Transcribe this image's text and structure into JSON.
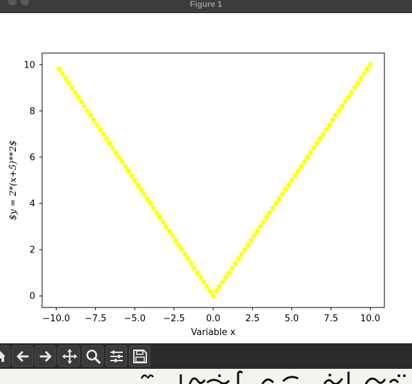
{
  "window": {
    "title": "Figure 1"
  },
  "chart_data": {
    "type": "scatter",
    "marker": "*",
    "color": "#ffff00",
    "title": "",
    "xlabel": "Variable x",
    "ylabel": "$y = 2*(x+5)**2$",
    "xlim": [
      -10.9,
      10.9
    ],
    "ylim": [
      -0.5,
      10.5
    ],
    "xticks": [
      -10.0,
      -7.5,
      -5.0,
      -2.5,
      0.0,
      2.5,
      5.0,
      7.5,
      10.0
    ],
    "xtick_labels": [
      "−10.0",
      "−7.5",
      "−5.0",
      "−2.5",
      "0.0",
      "2.5",
      "5.0",
      "7.5",
      "10.0"
    ],
    "yticks": [
      0,
      2,
      4,
      6,
      8,
      10
    ],
    "ytick_labels": [
      "0",
      "2",
      "4",
      "6",
      "8",
      "10"
    ],
    "grid": false,
    "series": [
      {
        "x_start": -9.8,
        "x_stop": 10.0,
        "x_step": 0.2,
        "y": "|x|"
      }
    ]
  },
  "toolbar": {
    "buttons": [
      {
        "name": "home-icon"
      },
      {
        "name": "back-arrow-icon"
      },
      {
        "name": "forward-arrow-icon"
      },
      {
        "name": "pan-icon"
      },
      {
        "name": "zoom-icon"
      },
      {
        "name": "configure-subplots-icon"
      },
      {
        "name": "save-icon"
      }
    ]
  }
}
